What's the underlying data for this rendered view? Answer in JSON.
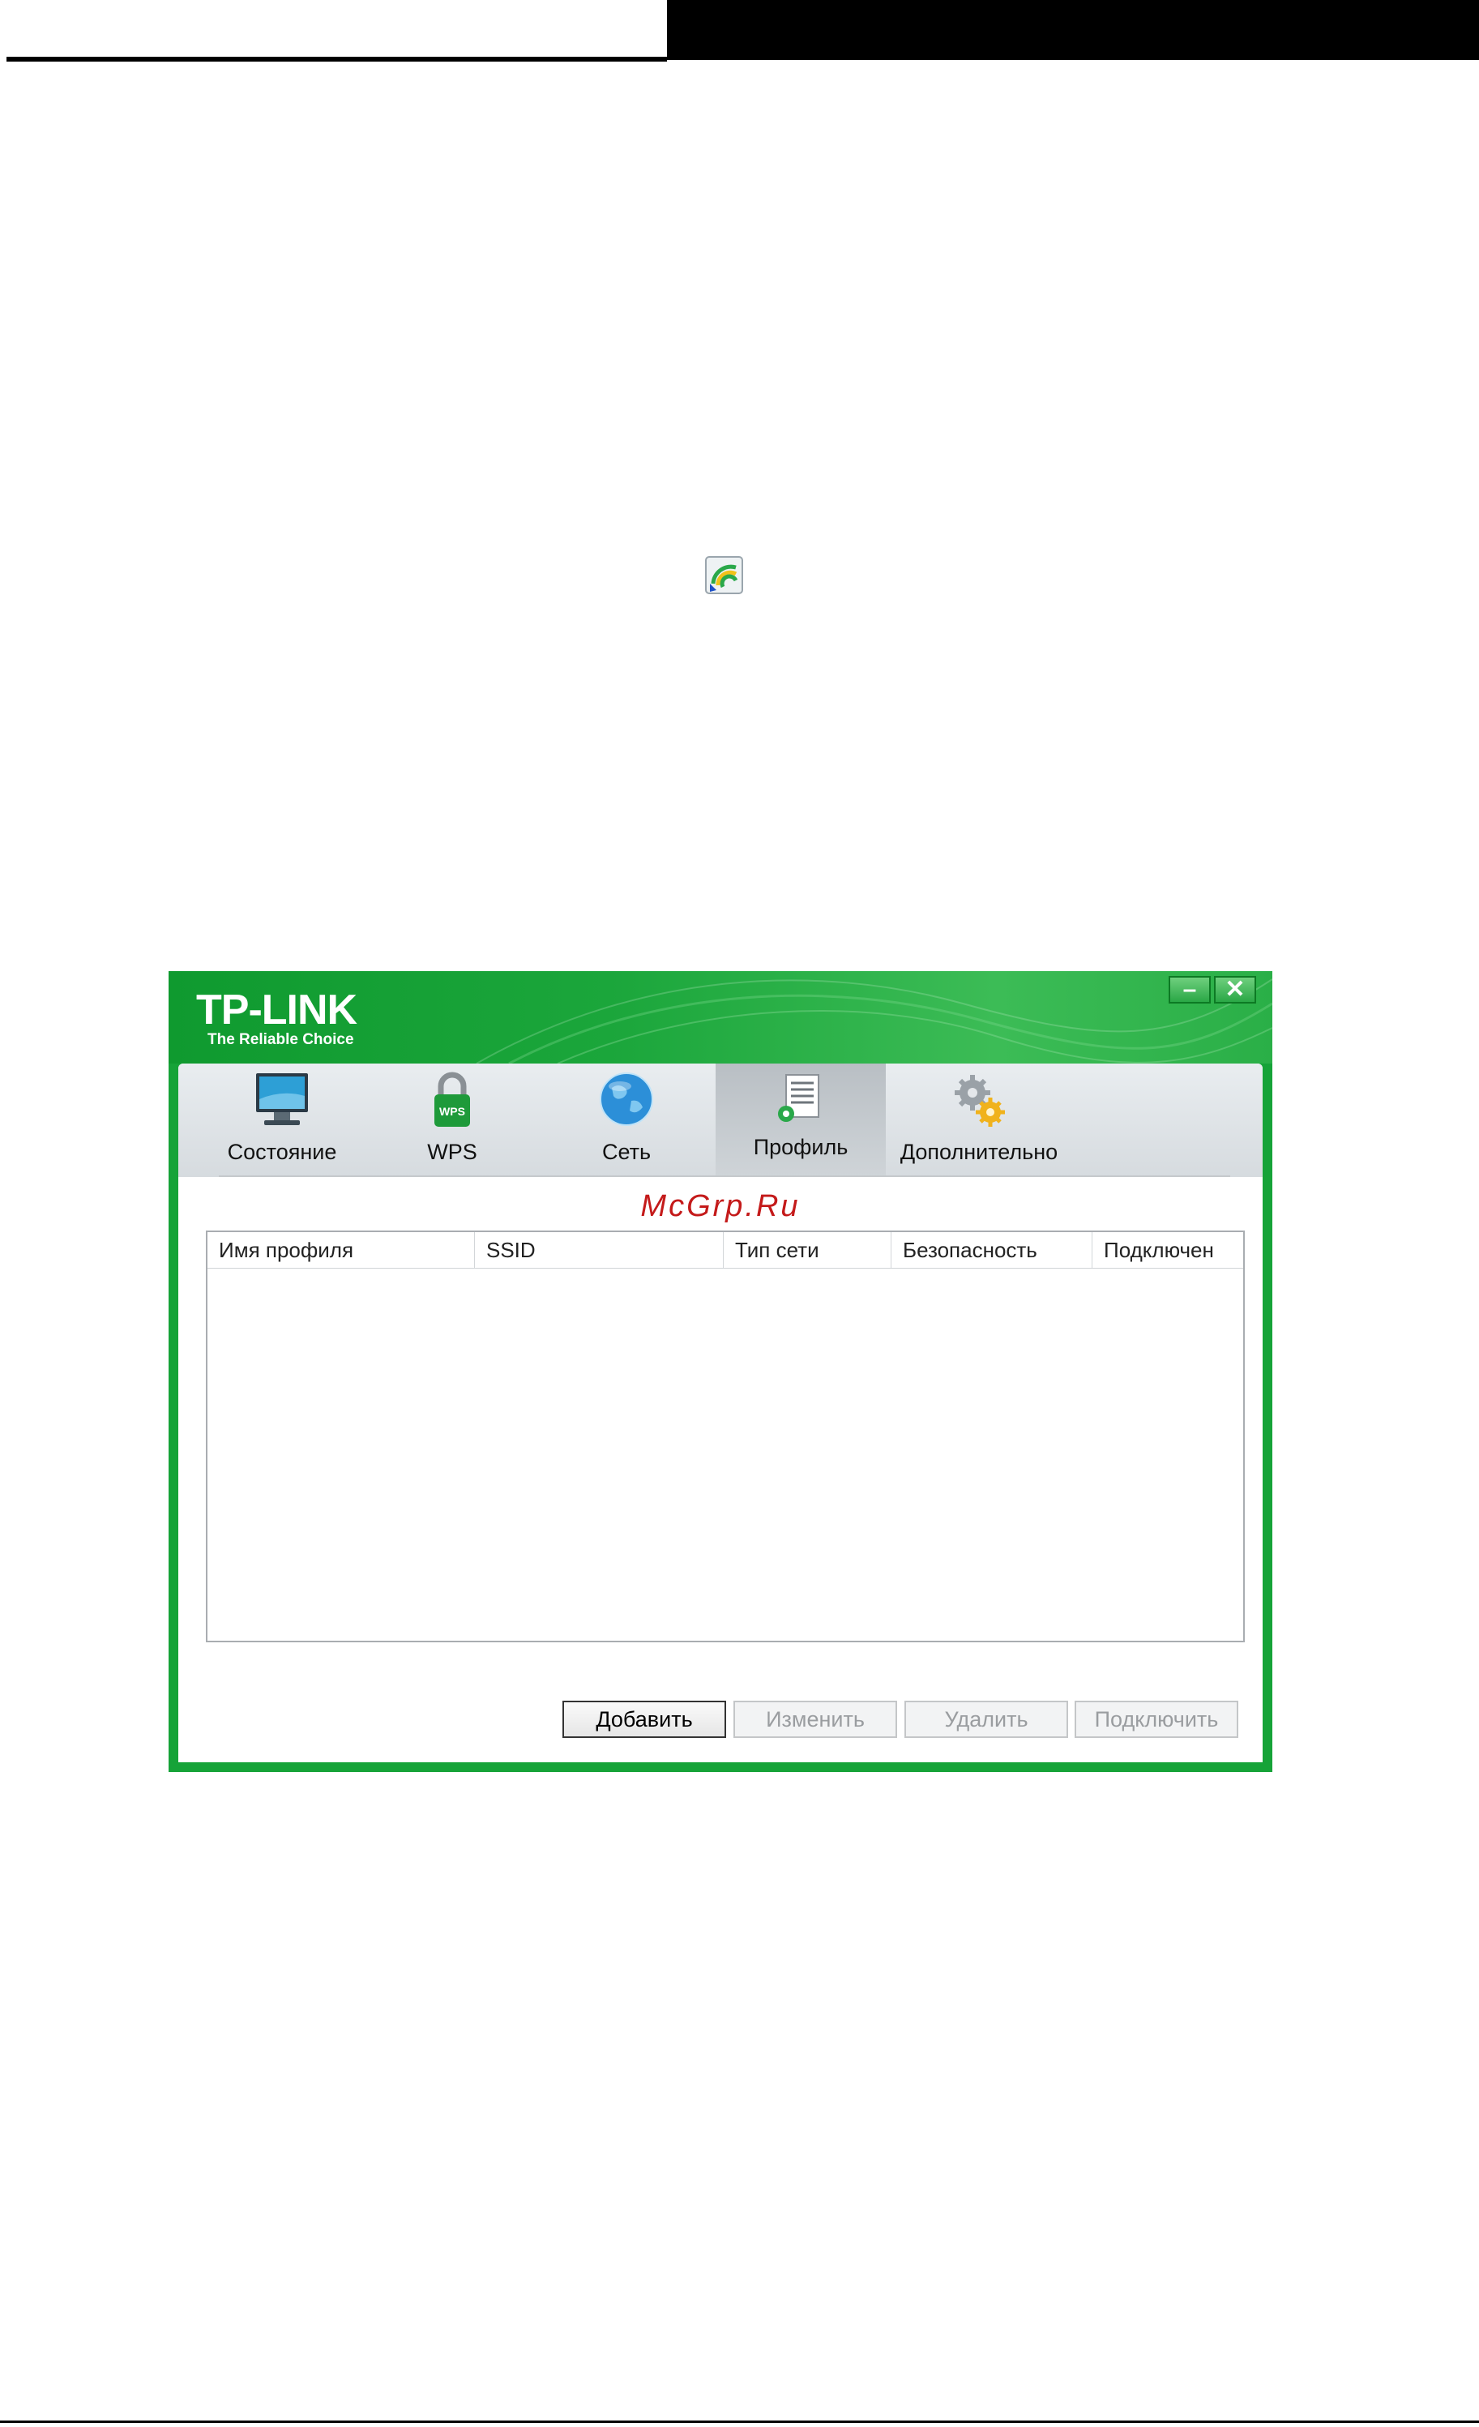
{
  "app": {
    "brand": "TP-LINK",
    "tagline": "The Reliable Choice",
    "accent_color": "#16a338",
    "window_controls": {
      "minimize": "–",
      "close": "✕"
    }
  },
  "nav": {
    "tabs": [
      {
        "label": "Состояние",
        "icon": "monitor-icon",
        "active": false
      },
      {
        "label": "WPS",
        "icon": "wps-lock-icon",
        "active": false
      },
      {
        "label": "Сеть",
        "icon": "globe-icon",
        "active": false
      },
      {
        "label": "Профиль",
        "icon": "profile-document-icon",
        "active": true
      },
      {
        "label": "Дополнительно",
        "icon": "gears-icon",
        "active": false
      }
    ]
  },
  "watermark": "McGrp.Ru",
  "table": {
    "columns": [
      "Имя профиля",
      "SSID",
      "Тип сети",
      "Безопасность",
      "Подключен"
    ],
    "rows": []
  },
  "buttons": {
    "add": "Добавить",
    "edit": "Изменить",
    "delete": "Удалить",
    "connect": "Подключить"
  },
  "tray_icon": "wifi-tray-icon"
}
